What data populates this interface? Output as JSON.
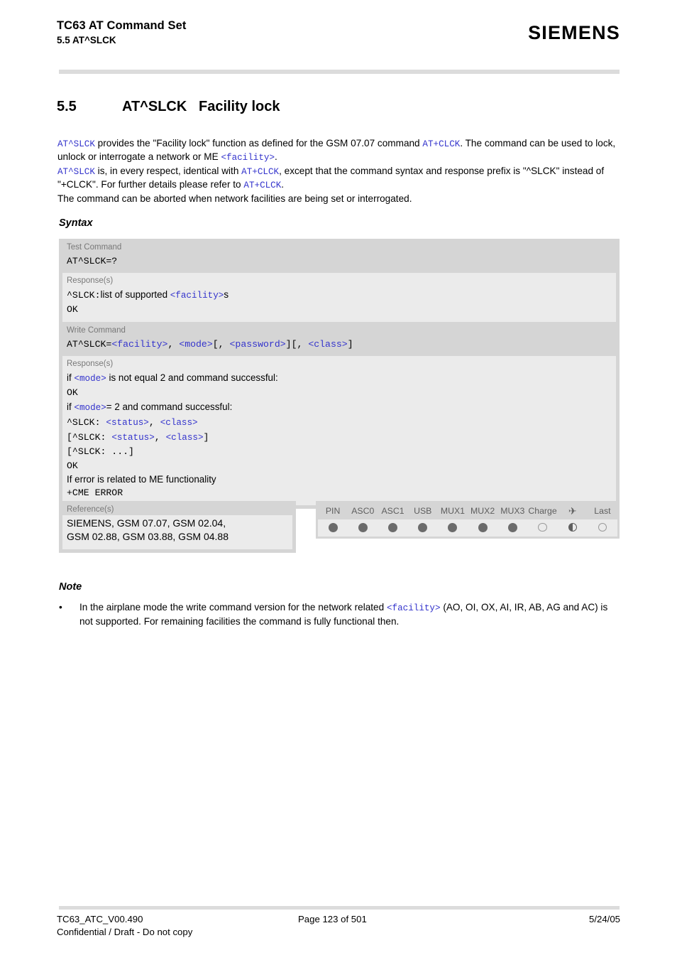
{
  "header": {
    "title": "TC63 AT Command Set",
    "subtitle": "5.5 AT^SLCK",
    "logo": "SIEMENS"
  },
  "section": {
    "number": "5.5",
    "command": "AT^SLCK",
    "name": "Facility lock"
  },
  "intro": {
    "p1_a": "AT^SLCK",
    "p1_b": " provides the \"Facility lock\" function as defined for the GSM 07.07 command ",
    "p1_c": "AT+CLCK",
    "p1_d": ". The command can be used to lock, unlock or interrogate a network or ME ",
    "p1_e": "<facility>",
    "p1_f": ".",
    "p2_a": "AT^SLCK",
    "p2_b": " is, in every respect, identical with ",
    "p2_c": "AT+CLCK",
    "p2_d": ", except that the command syntax and response prefix is \"^SLCK\" instead of \"+CLCK\". For further details please refer to ",
    "p2_e": "AT+CLCK",
    "p2_f": ".",
    "p3": "The command can be aborted when network facilities are being set or interrogated."
  },
  "syntax": {
    "label": "Syntax",
    "test": {
      "command_label": "Test Command",
      "command": "AT^SLCK=?",
      "response_label": "Response(s)",
      "r1_prefix": "^SLCK:",
      "r1_mid": "list of supported ",
      "r1_param": "<facility>",
      "r1_suffix": "s",
      "r2": "OK"
    },
    "write": {
      "command_label": "Write Command",
      "cmd_a": "AT^SLCK=",
      "cmd_b": "<facility>",
      "cmd_c": ", ",
      "cmd_d": "<mode>",
      "cmd_e": "[, ",
      "cmd_f": "<password>",
      "cmd_g": "][, ",
      "cmd_h": "<class>",
      "cmd_i": "]",
      "response_label": "Response(s)",
      "r1_a": "if ",
      "r1_b": "<mode>",
      "r1_c": " is not equal 2 and command successful:",
      "r2": "OK",
      "r3_a": "if ",
      "r3_b": "<mode>",
      "r3_c": "= 2 and command successful:",
      "r4_a": "^SLCK: ",
      "r4_b": "<status>",
      "r4_c": ", ",
      "r4_d": "<class>",
      "r5_a": "[^SLCK: ",
      "r5_b": "<status>",
      "r5_c": ", ",
      "r5_d": "<class>",
      "r5_e": "]",
      "r6": "[^SLCK: ...]",
      "r7": "OK",
      "r8": "If error is related to ME functionality",
      "r9": "+CME ERROR"
    }
  },
  "reference": {
    "label": "Reference(s)",
    "line1": "SIEMENS, GSM 07.07, GSM 02.04,",
    "line2": "GSM 02.88, GSM 03.88, GSM 04.88"
  },
  "indicators": {
    "columns": [
      {
        "label": "PIN",
        "state": "full"
      },
      {
        "label": "ASC0",
        "state": "full"
      },
      {
        "label": "ASC1",
        "state": "full"
      },
      {
        "label": "USB",
        "state": "full"
      },
      {
        "label": "MUX1",
        "state": "full"
      },
      {
        "label": "MUX2",
        "state": "full"
      },
      {
        "label": "MUX3",
        "state": "full"
      },
      {
        "label": "Charge",
        "state": "empty"
      },
      {
        "label": "✈",
        "state": "half"
      },
      {
        "label": "Last",
        "state": "empty"
      }
    ]
  },
  "note": {
    "label": "Note",
    "bullet": "•",
    "text_a": "In the airplane mode the write command version for the network related ",
    "text_b": "<facility>",
    "text_c": " (AO, OI, OX, AI, IR, AB, AG and AC) is not supported. For remaining facilities the command is fully functional then."
  },
  "footer": {
    "doc_id": "TC63_ATC_V00.490",
    "page": "Page 123 of 501",
    "date": "5/24/05",
    "confidential": "Confidential / Draft - Do not copy"
  },
  "colors": {
    "link_blue": "#3333cc",
    "box_dark": "#d5d5d5",
    "box_light": "#ebebeb",
    "dot_fill": "#6b6b6b"
  }
}
